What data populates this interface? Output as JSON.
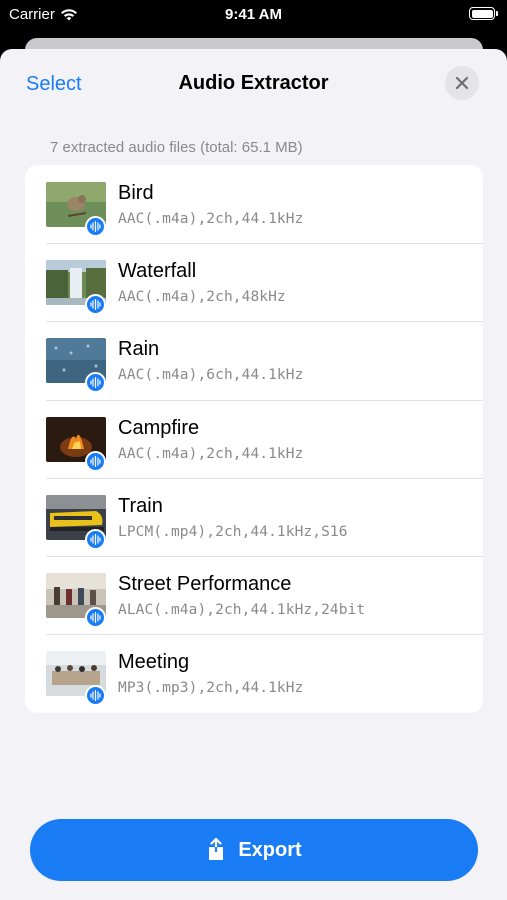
{
  "status_bar": {
    "carrier": "Carrier",
    "time": "9:41 AM"
  },
  "nav": {
    "select_label": "Select",
    "title": "Audio Extractor"
  },
  "summary": "7 extracted audio files (total: 65.1 MB)",
  "files": [
    {
      "name": "Bird",
      "meta": "AAC(.m4a),2ch,44.1kHz"
    },
    {
      "name": "Waterfall",
      "meta": "AAC(.m4a),2ch,48kHz"
    },
    {
      "name": "Rain",
      "meta": "AAC(.m4a),6ch,44.1kHz"
    },
    {
      "name": "Campfire",
      "meta": "AAC(.m4a),2ch,44.1kHz"
    },
    {
      "name": "Train",
      "meta": "LPCM(.mp4),2ch,44.1kHz,S16"
    },
    {
      "name": "Street Performance",
      "meta": "ALAC(.m4a),2ch,44.1kHz,24bit"
    },
    {
      "name": "Meeting",
      "meta": "MP3(.mp3),2ch,44.1kHz"
    }
  ],
  "export_label": "Export",
  "colors": {
    "accent": "#1a7cf5",
    "background": "#f2f2f7",
    "secondary_text": "#8a8a8e"
  },
  "icons": {
    "wifi": "wifi-icon",
    "battery": "battery-icon",
    "close": "close-icon",
    "waveform": "waveform-icon",
    "share": "share-icon"
  }
}
